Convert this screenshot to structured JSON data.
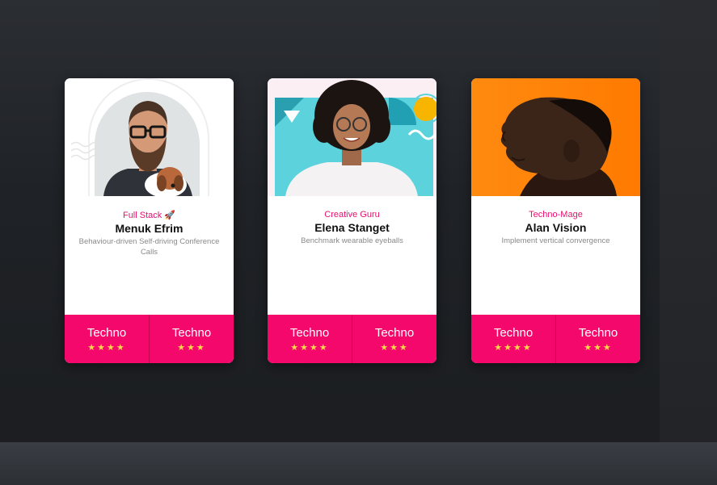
{
  "cards": [
    {
      "role": "Full Stack 🚀",
      "name": "Menuk Efrim",
      "description": "Behaviour-driven Self-driving Conference Calls",
      "skills": [
        {
          "label": "Techno",
          "stars": "★★★★"
        },
        {
          "label": "Techno",
          "stars": "★★★"
        }
      ]
    },
    {
      "role": "Creative Guru",
      "name": "Elena Stanget",
      "description": "Benchmark wearable eyeballs",
      "skills": [
        {
          "label": "Techno",
          "stars": "★★★★"
        },
        {
          "label": "Techno",
          "stars": "★★★"
        }
      ]
    },
    {
      "role": "Techno-Mage",
      "name": "Alan Vision",
      "description": "Implement vertical convergence",
      "skills": [
        {
          "label": "Techno",
          "stars": "★★★★"
        },
        {
          "label": "Techno",
          "stars": "★★★"
        }
      ]
    }
  ],
  "colors": {
    "accent": "#f5086c",
    "role_text": "#e6126f",
    "star": "#ffd84a",
    "background": "#1f2226"
  }
}
